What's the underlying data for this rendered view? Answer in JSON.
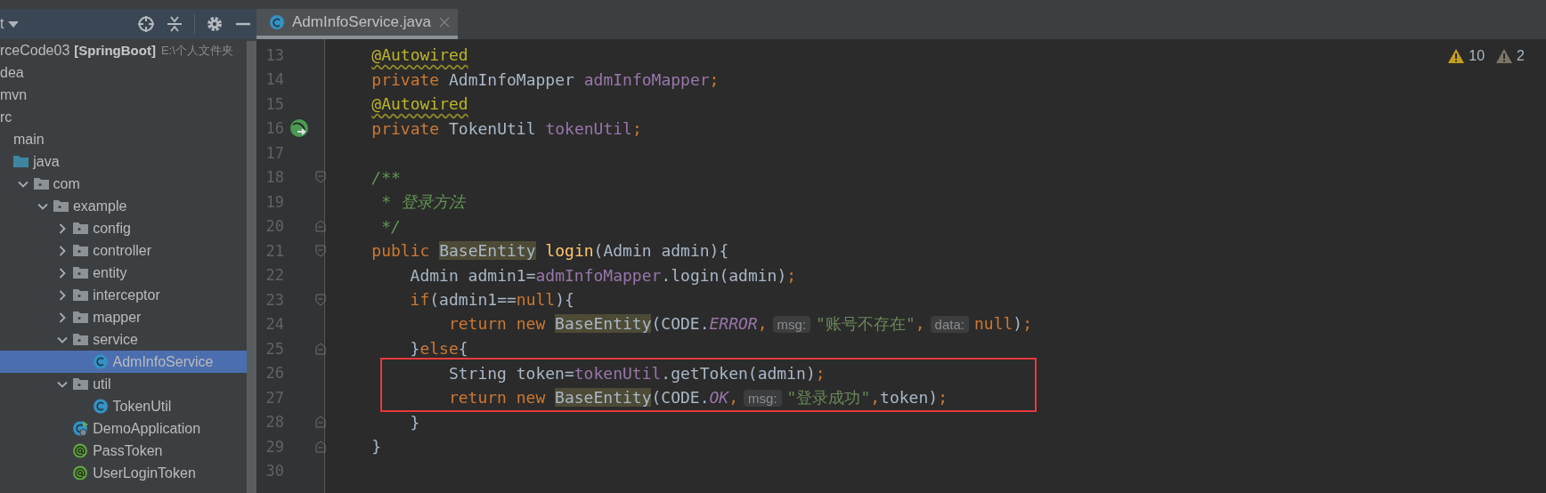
{
  "sidebar": {
    "toolbar": {
      "title": "t"
    },
    "project": {
      "name": "rceCode03",
      "module": "[SpringBoot]",
      "path": "E:\\个人文件夹"
    },
    "tree": [
      {
        "label": "dea",
        "selected": false
      },
      {
        "label": "mvn",
        "selected": false
      },
      {
        "label": "rc",
        "selected": false,
        "children": [
          {
            "label": "main",
            "selected": false,
            "children": [
              {
                "label": "java",
                "kind": "source-folder",
                "selected": false,
                "children": [
                  {
                    "label": "com",
                    "kind": "package",
                    "expanded": true,
                    "selected": false,
                    "children": [
                      {
                        "label": "example",
                        "kind": "package",
                        "expanded": true,
                        "selected": false,
                        "children": [
                          {
                            "label": "config",
                            "kind": "package",
                            "expanded": false,
                            "selected": false
                          },
                          {
                            "label": "controller",
                            "kind": "package",
                            "expanded": false,
                            "selected": false
                          },
                          {
                            "label": "entity",
                            "kind": "package",
                            "expanded": false,
                            "selected": false
                          },
                          {
                            "label": "interceptor",
                            "kind": "package",
                            "expanded": false,
                            "selected": false
                          },
                          {
                            "label": "mapper",
                            "kind": "package",
                            "expanded": false,
                            "selected": false
                          },
                          {
                            "label": "service",
                            "kind": "package",
                            "expanded": true,
                            "selected": false,
                            "children": [
                              {
                                "label": "AdmInfoService",
                                "kind": "class",
                                "selected": true
                              }
                            ]
                          },
                          {
                            "label": "util",
                            "kind": "package",
                            "expanded": true,
                            "selected": false,
                            "children": [
                              {
                                "label": "TokenUtil",
                                "kind": "class",
                                "selected": false
                              }
                            ]
                          },
                          {
                            "label": "DemoApplication",
                            "kind": "app",
                            "selected": false
                          },
                          {
                            "label": "PassToken",
                            "kind": "annotation",
                            "selected": false
                          },
                          {
                            "label": "UserLoginToken",
                            "kind": "annotation",
                            "selected": false
                          }
                        ]
                      }
                    ]
                  }
                ]
              }
            ]
          }
        ]
      }
    ]
  },
  "tabs": [
    {
      "label": "AdmInfoService.java",
      "selected": true
    }
  ],
  "editor": {
    "inspections": [
      {
        "count": "10",
        "kind": "warning"
      },
      {
        "count": "2",
        "kind": "weak"
      }
    ],
    "lines": [
      {
        "number": "13",
        "boxed": false,
        "tokens": [
          {
            "text": "@Autowired",
            "kind": "annotation"
          }
        ]
      },
      {
        "number": "14",
        "boxed": false,
        "tokens": [
          {
            "text": "private ",
            "kind": "keyword"
          },
          {
            "text": "AdmInfoMapper ",
            "kind": "plain"
          },
          {
            "text": "admInfoMapper",
            "kind": "field"
          },
          {
            "text": ";",
            "kind": "keyword"
          }
        ]
      },
      {
        "number": "15",
        "boxed": false,
        "tokens": [
          {
            "text": "@Autowired",
            "kind": "annotation"
          }
        ]
      },
      {
        "number": "16",
        "kind": "bean",
        "boxed": false,
        "tokens": [
          {
            "text": "private ",
            "kind": "keyword"
          },
          {
            "text": "TokenUtil ",
            "kind": "plain"
          },
          {
            "text": "tokenUtil",
            "kind": "field"
          },
          {
            "text": ";",
            "kind": "keyword"
          }
        ]
      },
      {
        "number": "17",
        "boxed": false
      },
      {
        "number": "18",
        "kind": "fold-start",
        "boxed": false,
        "tokens": [
          {
            "text": "/**",
            "kind": "comment"
          }
        ]
      },
      {
        "number": "19",
        "boxed": false,
        "tokens": [
          {
            "text": " * 登录方法",
            "kind": "comment"
          }
        ]
      },
      {
        "number": "20",
        "kind": "fold-end",
        "boxed": false,
        "tokens": [
          {
            "text": " */",
            "kind": "comment"
          }
        ]
      },
      {
        "number": "21",
        "kind": "fold-start",
        "boxed": false,
        "tokens": [
          {
            "text": "public ",
            "kind": "keyword"
          },
          {
            "text": "BaseEntity",
            "kind": "highlight"
          },
          {
            "text": " login",
            "kind": "method"
          },
          {
            "text": "(Admin admin){",
            "kind": "plain"
          }
        ],
        "children": [
          {
            "number": "22",
            "boxed": false,
            "tokens": [
              {
                "text": "Admin admin1=",
                "kind": "plain"
              },
              {
                "text": "admInfoMapper",
                "kind": "field"
              },
              {
                "text": ".login(admin)",
                "kind": "plain"
              },
              {
                "text": ";",
                "kind": "keyword"
              }
            ]
          },
          {
            "number": "23",
            "kind": "fold-start",
            "boxed": false,
            "tokens": [
              {
                "text": "if",
                "kind": "keyword"
              },
              {
                "text": "(admin1==",
                "kind": "plain"
              },
              {
                "text": "null",
                "kind": "keyword"
              },
              {
                "text": "){",
                "kind": "plain"
              }
            ],
            "children": [
              {
                "number": "24",
                "boxed": false,
                "tokens": [
                  {
                    "text": "return new ",
                    "kind": "keyword"
                  },
                  {
                    "text": "BaseEntity",
                    "kind": "highlight"
                  },
                  {
                    "text": "(CODE.",
                    "kind": "plain"
                  },
                  {
                    "text": "ERROR",
                    "kind": "constant"
                  },
                  {
                    "text": ",",
                    "kind": "keyword"
                  },
                  {
                    "text": "msg:",
                    "kind": "hint"
                  },
                  {
                    "text": "\"账号不存在\"",
                    "kind": "string"
                  },
                  {
                    "text": ",",
                    "kind": "keyword"
                  },
                  {
                    "text": "data:",
                    "kind": "hint"
                  },
                  {
                    "text": "null",
                    "kind": "keyword"
                  },
                  {
                    "text": ")",
                    "kind": "plain"
                  },
                  {
                    "text": ";",
                    "kind": "keyword"
                  }
                ]
              }
            ]
          },
          {
            "number": "25",
            "kind": "fold-end",
            "boxed": false,
            "tokens": [
              {
                "text": "}",
                "kind": "plain"
              },
              {
                "text": "else",
                "kind": "keyword"
              },
              {
                "text": "{",
                "kind": "plain"
              }
            ],
            "children": [
              {
                "number": "26",
                "boxed": true,
                "tokens": [
                  {
                    "text": "String token=",
                    "kind": "plain"
                  },
                  {
                    "text": "tokenUtil",
                    "kind": "field"
                  },
                  {
                    "text": ".getToken(admin)",
                    "kind": "plain"
                  },
                  {
                    "text": ";",
                    "kind": "keyword"
                  }
                ]
              },
              {
                "number": "27",
                "boxed": true,
                "tokens": [
                  {
                    "text": "return new ",
                    "kind": "keyword"
                  },
                  {
                    "text": "BaseEntity",
                    "kind": "highlight"
                  },
                  {
                    "text": "(CODE.",
                    "kind": "plain"
                  },
                  {
                    "text": "OK",
                    "kind": "constant"
                  },
                  {
                    "text": ",",
                    "kind": "keyword"
                  },
                  {
                    "text": "msg:",
                    "kind": "hint"
                  },
                  {
                    "text": "\"登录成功\"",
                    "kind": "string"
                  },
                  {
                    "text": ",",
                    "kind": "keyword"
                  },
                  {
                    "text": "token)",
                    "kind": "plain"
                  },
                  {
                    "text": ";",
                    "kind": "keyword"
                  }
                ]
              }
            ]
          },
          {
            "number": "28",
            "kind": "fold-end",
            "boxed": false,
            "tokens": [
              {
                "text": "}",
                "kind": "plain"
              }
            ]
          }
        ]
      },
      {
        "number": "29",
        "kind": "fold-end",
        "boxed": false,
        "tokens": [
          {
            "text": "}",
            "kind": "plain"
          }
        ]
      },
      {
        "number": "30",
        "boxed": false
      }
    ]
  }
}
